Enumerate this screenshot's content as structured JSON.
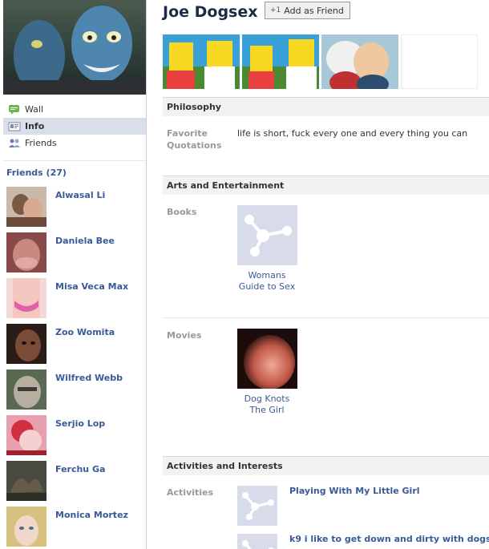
{
  "profile": {
    "name": "Joe Dogsex",
    "add_friend_label": "Add as Friend"
  },
  "nav": {
    "items": [
      {
        "label": "Wall",
        "icon": "wall-icon"
      },
      {
        "label": "Info",
        "icon": "info-icon"
      },
      {
        "label": "Friends",
        "icon": "friends-icon"
      }
    ]
  },
  "friends": {
    "heading": "Friends (27)",
    "list": [
      {
        "name": "Alwasal Li"
      },
      {
        "name": "Daniela Bee"
      },
      {
        "name": "Misa Veca Max"
      },
      {
        "name": "Zoo Womita"
      },
      {
        "name": "Wilfred Webb"
      },
      {
        "name": "Serjio Lop"
      },
      {
        "name": "Ferchu Ga"
      },
      {
        "name": "Monica Mortez"
      }
    ]
  },
  "sections": {
    "philosophy": {
      "title": "Philosophy",
      "label": "Favorite\nQuotations",
      "value": "life is short, fuck every one and every thing you can"
    },
    "arts": {
      "title": "Arts and Entertainment",
      "books_label": "Books",
      "book_title": "Womans\nGuide to Sex",
      "movies_label": "Movies",
      "movie_title": "Dog Knots\nThe Girl"
    },
    "activities": {
      "title": "Activities and Interests",
      "label": "Activities",
      "items": [
        {
          "name": "Playing With My Little Girl"
        },
        {
          "name": "k9 i like to get down and dirty with dogs!"
        }
      ]
    }
  },
  "colors": {
    "link": "#3b5998",
    "nav_active_bg": "#d8dfea",
    "placeholder_bg": "#d8dbea"
  }
}
